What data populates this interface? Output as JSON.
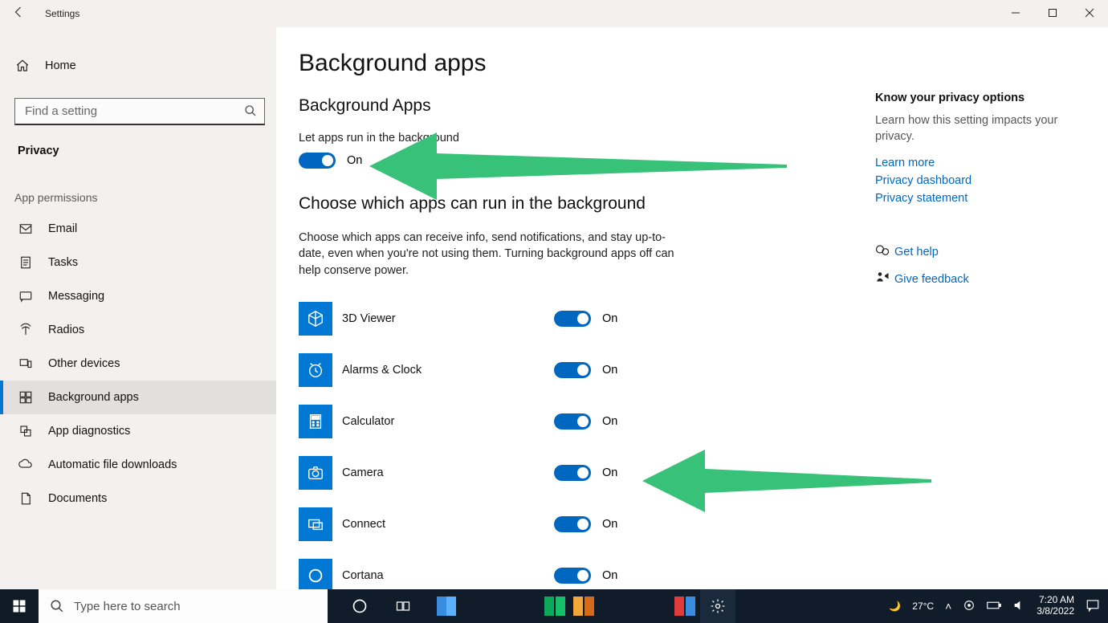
{
  "window": {
    "title": "Settings"
  },
  "sidebar": {
    "home": "Home",
    "search_placeholder": "Find a setting",
    "section": "Privacy",
    "permissions_label": "App permissions",
    "items": [
      {
        "label": "Email"
      },
      {
        "label": "Tasks"
      },
      {
        "label": "Messaging"
      },
      {
        "label": "Radios"
      },
      {
        "label": "Other devices"
      },
      {
        "label": "Background apps"
      },
      {
        "label": "App diagnostics"
      },
      {
        "label": "Automatic file downloads"
      },
      {
        "label": "Documents"
      }
    ],
    "active_index": 5
  },
  "main": {
    "title": "Background apps",
    "section1": "Background Apps",
    "master_label": "Let apps run in the background",
    "master_state": "On",
    "section2": "Choose which apps can run in the background",
    "description": "Choose which apps can receive info, send notifications, and stay up-to-date, even when you're not using them. Turning background apps off can help conserve power.",
    "apps": [
      {
        "name": "3D Viewer",
        "state": "On"
      },
      {
        "name": "Alarms & Clock",
        "state": "On"
      },
      {
        "name": "Calculator",
        "state": "On"
      },
      {
        "name": "Camera",
        "state": "On"
      },
      {
        "name": "Connect",
        "state": "On"
      },
      {
        "name": "Cortana",
        "state": "On"
      }
    ]
  },
  "aside": {
    "heading": "Know your privacy options",
    "info": "Learn how this setting impacts your privacy.",
    "links": [
      "Learn more",
      "Privacy dashboard",
      "Privacy statement"
    ],
    "help": "Get help",
    "feedback": "Give feedback"
  },
  "taskbar": {
    "search_placeholder": "Type here to search",
    "weather_temp": "27°C",
    "time": "7:20 AM",
    "date": "3/8/2022"
  },
  "annotations": {
    "arrow_color": "#38c178"
  }
}
